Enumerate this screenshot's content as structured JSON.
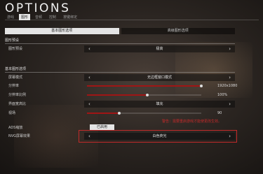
{
  "header": {
    "title": "OPTIONS",
    "tabs": [
      {
        "label": "游戏",
        "active": false
      },
      {
        "label": "图形",
        "active": true
      },
      {
        "label": "音频",
        "active": false
      },
      {
        "label": "控制",
        "active": false
      },
      {
        "label": "按键绑定",
        "active": false
      }
    ]
  },
  "subtabs": [
    {
      "label": "基本图形选项",
      "active": true
    },
    {
      "label": "高级图形选项",
      "active": false
    }
  ],
  "preset_section": {
    "title": "图形预设",
    "rows": [
      {
        "label": "图形预设",
        "value": "极高"
      }
    ]
  },
  "basic_section": {
    "title": "基本图形选项",
    "display_mode": {
      "label": "屏幕模式",
      "value": "无边框窗口模式"
    },
    "resolution": {
      "label": "分辨率",
      "value": "1920x1080",
      "level": 1.0
    },
    "resolution_scale": {
      "label": "分辨率比例",
      "value": "100%",
      "level": 0.53
    },
    "aspect_ratio": {
      "label": "界面宽高比",
      "value": "填充"
    },
    "fov": {
      "label": "视场",
      "value": "90",
      "level": 0.28
    },
    "ads_zoom": {
      "label": "ADS缩放",
      "value": "已启用"
    },
    "nvg": {
      "label": "NVG屏幕效果",
      "value": "白色荧光"
    }
  },
  "warning_text": "警告：需要重启游戏才能使更改生效。",
  "colors": {
    "accent": "#a01515",
    "warning": "#c62a2a"
  },
  "icons": {
    "left": "chevron-left-icon",
    "right": "chevron-right-icon"
  }
}
